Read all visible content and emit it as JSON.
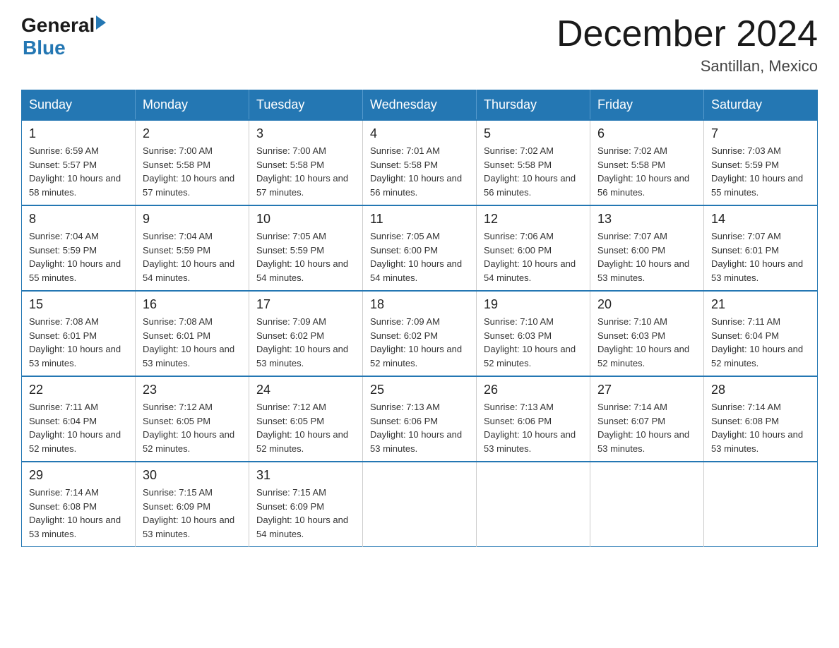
{
  "header": {
    "logo_general": "General",
    "logo_blue": "Blue",
    "month_title": "December 2024",
    "location": "Santillan, Mexico"
  },
  "days_of_week": [
    "Sunday",
    "Monday",
    "Tuesday",
    "Wednesday",
    "Thursday",
    "Friday",
    "Saturday"
  ],
  "weeks": [
    [
      {
        "day": "1",
        "sunrise": "6:59 AM",
        "sunset": "5:57 PM",
        "daylight": "10 hours and 58 minutes."
      },
      {
        "day": "2",
        "sunrise": "7:00 AM",
        "sunset": "5:58 PM",
        "daylight": "10 hours and 57 minutes."
      },
      {
        "day": "3",
        "sunrise": "7:00 AM",
        "sunset": "5:58 PM",
        "daylight": "10 hours and 57 minutes."
      },
      {
        "day": "4",
        "sunrise": "7:01 AM",
        "sunset": "5:58 PM",
        "daylight": "10 hours and 56 minutes."
      },
      {
        "day": "5",
        "sunrise": "7:02 AM",
        "sunset": "5:58 PM",
        "daylight": "10 hours and 56 minutes."
      },
      {
        "day": "6",
        "sunrise": "7:02 AM",
        "sunset": "5:58 PM",
        "daylight": "10 hours and 56 minutes."
      },
      {
        "day": "7",
        "sunrise": "7:03 AM",
        "sunset": "5:59 PM",
        "daylight": "10 hours and 55 minutes."
      }
    ],
    [
      {
        "day": "8",
        "sunrise": "7:04 AM",
        "sunset": "5:59 PM",
        "daylight": "10 hours and 55 minutes."
      },
      {
        "day": "9",
        "sunrise": "7:04 AM",
        "sunset": "5:59 PM",
        "daylight": "10 hours and 54 minutes."
      },
      {
        "day": "10",
        "sunrise": "7:05 AM",
        "sunset": "5:59 PM",
        "daylight": "10 hours and 54 minutes."
      },
      {
        "day": "11",
        "sunrise": "7:05 AM",
        "sunset": "6:00 PM",
        "daylight": "10 hours and 54 minutes."
      },
      {
        "day": "12",
        "sunrise": "7:06 AM",
        "sunset": "6:00 PM",
        "daylight": "10 hours and 54 minutes."
      },
      {
        "day": "13",
        "sunrise": "7:07 AM",
        "sunset": "6:00 PM",
        "daylight": "10 hours and 53 minutes."
      },
      {
        "day": "14",
        "sunrise": "7:07 AM",
        "sunset": "6:01 PM",
        "daylight": "10 hours and 53 minutes."
      }
    ],
    [
      {
        "day": "15",
        "sunrise": "7:08 AM",
        "sunset": "6:01 PM",
        "daylight": "10 hours and 53 minutes."
      },
      {
        "day": "16",
        "sunrise": "7:08 AM",
        "sunset": "6:01 PM",
        "daylight": "10 hours and 53 minutes."
      },
      {
        "day": "17",
        "sunrise": "7:09 AM",
        "sunset": "6:02 PM",
        "daylight": "10 hours and 53 minutes."
      },
      {
        "day": "18",
        "sunrise": "7:09 AM",
        "sunset": "6:02 PM",
        "daylight": "10 hours and 52 minutes."
      },
      {
        "day": "19",
        "sunrise": "7:10 AM",
        "sunset": "6:03 PM",
        "daylight": "10 hours and 52 minutes."
      },
      {
        "day": "20",
        "sunrise": "7:10 AM",
        "sunset": "6:03 PM",
        "daylight": "10 hours and 52 minutes."
      },
      {
        "day": "21",
        "sunrise": "7:11 AM",
        "sunset": "6:04 PM",
        "daylight": "10 hours and 52 minutes."
      }
    ],
    [
      {
        "day": "22",
        "sunrise": "7:11 AM",
        "sunset": "6:04 PM",
        "daylight": "10 hours and 52 minutes."
      },
      {
        "day": "23",
        "sunrise": "7:12 AM",
        "sunset": "6:05 PM",
        "daylight": "10 hours and 52 minutes."
      },
      {
        "day": "24",
        "sunrise": "7:12 AM",
        "sunset": "6:05 PM",
        "daylight": "10 hours and 52 minutes."
      },
      {
        "day": "25",
        "sunrise": "7:13 AM",
        "sunset": "6:06 PM",
        "daylight": "10 hours and 53 minutes."
      },
      {
        "day": "26",
        "sunrise": "7:13 AM",
        "sunset": "6:06 PM",
        "daylight": "10 hours and 53 minutes."
      },
      {
        "day": "27",
        "sunrise": "7:14 AM",
        "sunset": "6:07 PM",
        "daylight": "10 hours and 53 minutes."
      },
      {
        "day": "28",
        "sunrise": "7:14 AM",
        "sunset": "6:08 PM",
        "daylight": "10 hours and 53 minutes."
      }
    ],
    [
      {
        "day": "29",
        "sunrise": "7:14 AM",
        "sunset": "6:08 PM",
        "daylight": "10 hours and 53 minutes."
      },
      {
        "day": "30",
        "sunrise": "7:15 AM",
        "sunset": "6:09 PM",
        "daylight": "10 hours and 53 minutes."
      },
      {
        "day": "31",
        "sunrise": "7:15 AM",
        "sunset": "6:09 PM",
        "daylight": "10 hours and 54 minutes."
      },
      null,
      null,
      null,
      null
    ]
  ]
}
